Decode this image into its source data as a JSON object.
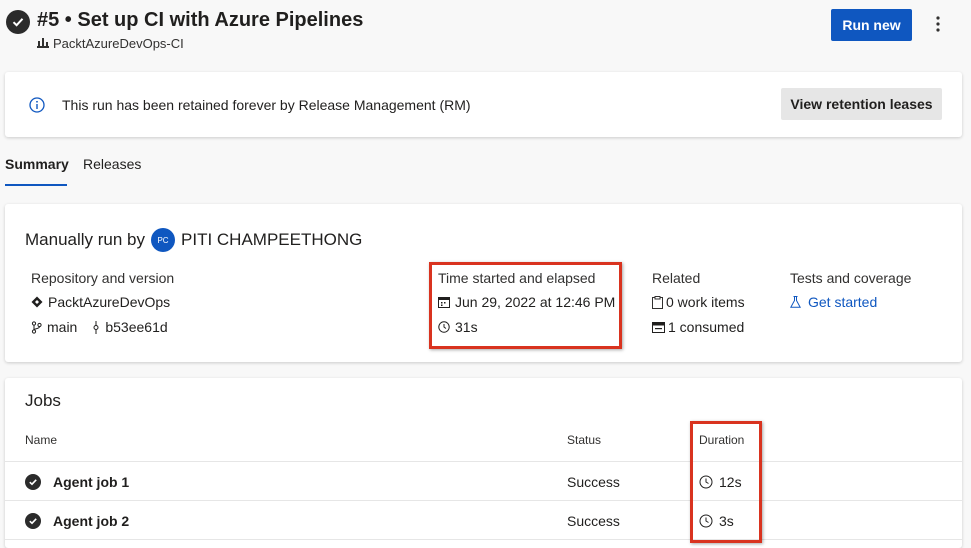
{
  "header": {
    "title": "#5 • Set up CI with Azure Pipelines",
    "pipeline": "PacktAzureDevOps-CI",
    "run_new_label": "Run new"
  },
  "banner": {
    "message": "This run has been retained forever by Release Management (RM)",
    "button_label": "View retention leases"
  },
  "tabs": [
    {
      "label": "Summary",
      "active": true
    },
    {
      "label": "Releases",
      "active": false
    }
  ],
  "summary": {
    "manual_run_label": "Manually run by",
    "user_initials": "PC",
    "user_name": "PITI CHAMPEETHONG",
    "repository": {
      "heading": "Repository and version",
      "repo": "PacktAzureDevOps",
      "branch": "main",
      "commit": "b53ee61d"
    },
    "time": {
      "heading": "Time started and elapsed",
      "started": "Jun 29, 2022 at 12:46 PM",
      "elapsed": "31s"
    },
    "related": {
      "heading": "Related",
      "work_items": "0 work items",
      "consumed": "1 consumed"
    },
    "tests": {
      "heading": "Tests and coverage",
      "link": "Get started"
    }
  },
  "jobs": {
    "title": "Jobs",
    "columns": {
      "name": "Name",
      "status": "Status",
      "duration": "Duration"
    },
    "rows": [
      {
        "name": "Agent job 1",
        "status": "Success",
        "duration": "12s"
      },
      {
        "name": "Agent job 2",
        "status": "Success",
        "duration": "3s"
      }
    ]
  },
  "colors": {
    "accent": "#0f57c0",
    "highlight": "#d9331f",
    "success_icon": "#2b2b2b"
  },
  "icons": {
    "status": "check-circle-icon",
    "pipeline": "pipeline-icon",
    "more": "more-vertical-icon",
    "info": "info-icon",
    "repo": "repo-icon",
    "branch": "branch-icon",
    "commit": "commit-icon",
    "calendar": "calendar-icon",
    "clock": "clock-icon",
    "work_items": "clipboard-icon",
    "consumed": "artifact-icon",
    "tests": "flask-icon"
  }
}
